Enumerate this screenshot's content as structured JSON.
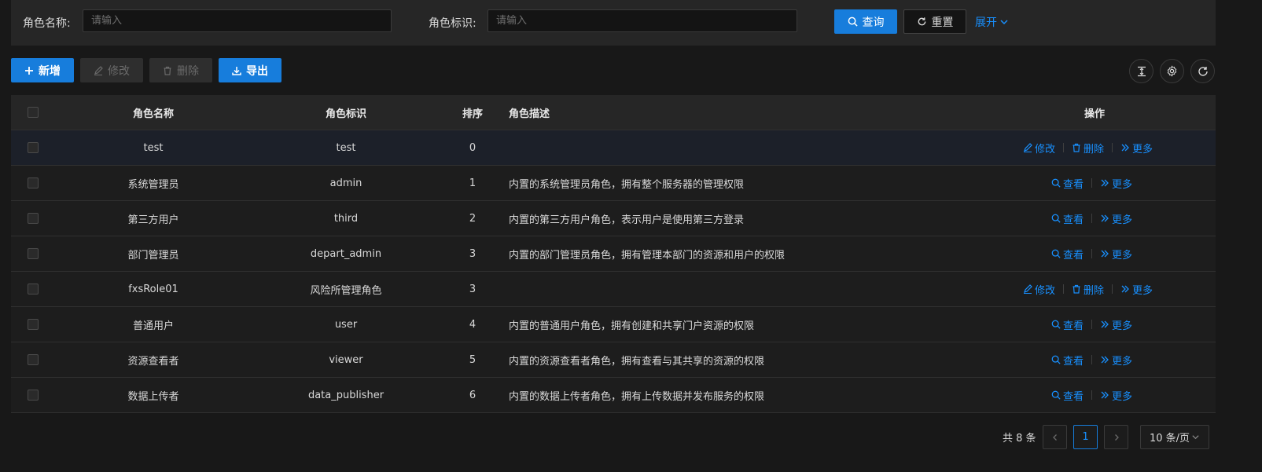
{
  "search": {
    "role_name_label": "角色名称:",
    "role_name_placeholder": "请输入",
    "role_key_label": "角色标识:",
    "role_key_placeholder": "请输入",
    "query_label": "查询",
    "reset_label": "重置",
    "expand_label": "展开"
  },
  "toolbar": {
    "add_label": "新增",
    "edit_label": "修改",
    "delete_label": "删除",
    "export_label": "导出"
  },
  "table": {
    "columns": {
      "name": "角色名称",
      "key": "角色标识",
      "sort": "排序",
      "desc": "角色描述",
      "ops": "操作"
    },
    "rows": [
      {
        "name": "test",
        "key": "test",
        "sort": "0",
        "desc": "",
        "ops": [
          "修改",
          "删除",
          "更多"
        ]
      },
      {
        "name": "系统管理员",
        "key": "admin",
        "sort": "1",
        "desc": "内置的系统管理员角色，拥有整个服务器的管理权限",
        "ops": [
          "查看",
          "更多"
        ]
      },
      {
        "name": "第三方用户",
        "key": "third",
        "sort": "2",
        "desc": "内置的第三方用户角色，表示用户是使用第三方登录",
        "ops": [
          "查看",
          "更多"
        ]
      },
      {
        "name": "部门管理员",
        "key": "depart_admin",
        "sort": "3",
        "desc": "内置的部门管理员角色，拥有管理本部门的资源和用户的权限",
        "ops": [
          "查看",
          "更多"
        ]
      },
      {
        "name": "fxsRole01",
        "key": "风险所管理角色",
        "sort": "3",
        "desc": "",
        "ops": [
          "修改",
          "删除",
          "更多"
        ]
      },
      {
        "name": "普通用户",
        "key": "user",
        "sort": "4",
        "desc": "内置的普通用户角色，拥有创建和共享门户资源的权限",
        "ops": [
          "查看",
          "更多"
        ]
      },
      {
        "name": "资源查看者",
        "key": "viewer",
        "sort": "5",
        "desc": "内置的资源查看者角色，拥有查看与其共享的资源的权限",
        "ops": [
          "查看",
          "更多"
        ]
      },
      {
        "name": "数据上传者",
        "key": "data_publisher",
        "sort": "6",
        "desc": "内置的数据上传者角色，拥有上传数据并发布服务的权限",
        "ops": [
          "查看",
          "更多"
        ]
      }
    ]
  },
  "pagination": {
    "total_label": "共 8 条",
    "current_page": "1",
    "page_size_label": "10 条/页"
  },
  "colors": {
    "primary": "#177ddc",
    "link": "#1890ff",
    "background": "#181818"
  }
}
